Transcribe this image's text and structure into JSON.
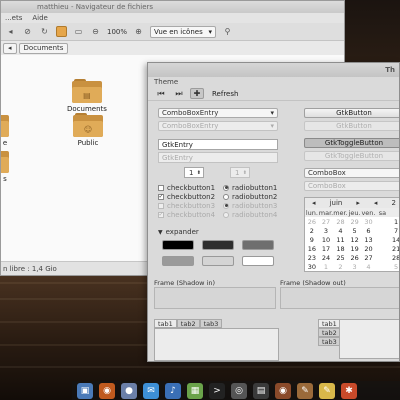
{
  "file_manager": {
    "title": "matthieu - Navigateur de fichiers",
    "menu": [
      "...ets",
      "Aide"
    ],
    "zoom": "100%",
    "view_mode": "Vue en icônes",
    "path": [
      "Documents"
    ],
    "folders": [
      {
        "name": "Documents",
        "icon": "folder-documents-icon"
      },
      {
        "name": "Public",
        "icon": "folder-public-icon"
      },
      {
        "name": "e",
        "icon": "folder-icon"
      },
      {
        "name": "s",
        "icon": "folder-icon"
      }
    ],
    "status": "n libre : 1,4 Gio"
  },
  "theme_window": {
    "title": "Th",
    "menu": "Theme",
    "refresh_label": "Refresh",
    "combo_entry": "ComboBoxEntry",
    "combo_entry_disabled": "ComboBoxEntry",
    "gtk_entry": "GtkEntry",
    "gtk_entry_disabled": "GtkEntry",
    "spin_value": "1",
    "spin_value_disabled": "1",
    "checks": [
      {
        "label": "checkbutton1",
        "checked": false,
        "disabled": false
      },
      {
        "label": "checkbutton2",
        "checked": true,
        "disabled": false
      },
      {
        "label": "checkbutton3",
        "checked": false,
        "disabled": true
      },
      {
        "label": "checkbutton4",
        "checked": true,
        "disabled": true
      }
    ],
    "radios": [
      {
        "label": "radiobutton1",
        "checked": true,
        "disabled": false
      },
      {
        "label": "radiobutton2",
        "checked": false,
        "disabled": false
      },
      {
        "label": "radiobutton3",
        "checked": true,
        "disabled": true
      },
      {
        "label": "radiobutton4",
        "checked": false,
        "disabled": true
      }
    ],
    "expander": "expander",
    "swatch_colors": [
      "#000000",
      "#2e2e2e",
      "#6e6e6e",
      "#9a9a9a",
      "#d4d4d4",
      "#ffffff"
    ],
    "buttons": {
      "gtk_button": "GtkButton",
      "gtk_button_disabled": "GtkButton",
      "toggle": "GtkToggleButton",
      "toggle_disabled": "GtkToggleButton",
      "combo": "ComboBox",
      "combo_disabled": "ComboBox"
    },
    "calendar": {
      "month": "juin",
      "year": "2",
      "weekdays": [
        "lun.",
        "mar.",
        "mer.",
        "jeu.",
        "ven.",
        "sa",
        ""
      ],
      "days": [
        [
          "26",
          "27",
          "28",
          "29",
          "30",
          "",
          ""
        ],
        [
          "2",
          "3",
          "4",
          "5",
          "6",
          "",
          ""
        ],
        [
          "9",
          "10",
          "11",
          "12",
          "13",
          "",
          ""
        ],
        [
          "16",
          "17",
          "18",
          "19",
          "20",
          "",
          ""
        ],
        [
          "23",
          "24",
          "25",
          "26",
          "27",
          "",
          ""
        ],
        [
          "30",
          "1",
          "2",
          "3",
          "4",
          "",
          ""
        ]
      ],
      "extra_col": [
        "1",
        "7",
        "14",
        "21",
        "28",
        "5"
      ]
    },
    "frame_in": "Frame (Shadow in)",
    "frame_out": "Frame (Shadow out)",
    "tabs_top": [
      "tab1",
      "tab2",
      "tab3"
    ],
    "tabs_left": [
      "tab1",
      "tab2",
      "tab3"
    ]
  },
  "dock": {
    "icons": [
      {
        "name": "finder-icon",
        "color": "#4a7ab8",
        "glyph": "▣"
      },
      {
        "name": "firefox-icon",
        "color": "#c05a1e",
        "glyph": "◉"
      },
      {
        "name": "pidgin-icon",
        "color": "#6b7fa8",
        "glyph": "●"
      },
      {
        "name": "mail-icon",
        "color": "#3d8fd6",
        "glyph": "✉"
      },
      {
        "name": "music-icon",
        "color": "#3a6fb6",
        "glyph": "♪"
      },
      {
        "name": "photos-icon",
        "color": "#6aa34a",
        "glyph": "▦"
      },
      {
        "name": "terminal-icon",
        "color": "#222222",
        "glyph": ">"
      },
      {
        "name": "dvd-icon",
        "color": "#555555",
        "glyph": "◎"
      },
      {
        "name": "video-icon",
        "color": "#3a3a3a",
        "glyph": "▤"
      },
      {
        "name": "media-icon",
        "color": "#8a4a2a",
        "glyph": "◉"
      },
      {
        "name": "draw-icon",
        "color": "#9a6a3a",
        "glyph": "✎"
      },
      {
        "name": "notes-icon",
        "color": "#d8b84a",
        "glyph": "✎"
      },
      {
        "name": "paint-icon",
        "color": "#c84a2a",
        "glyph": "✱"
      }
    ]
  }
}
